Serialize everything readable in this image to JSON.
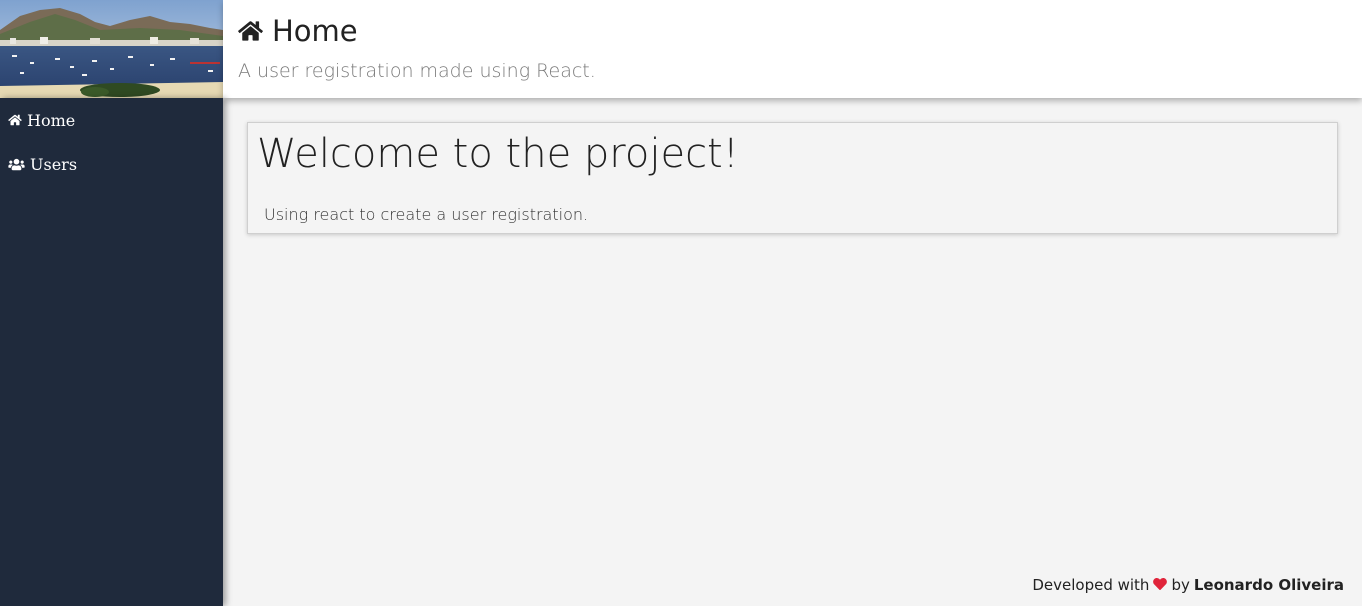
{
  "header": {
    "title": "Home",
    "subtitle": "A user registration made using React.",
    "icon": "home-icon"
  },
  "sidebar": {
    "items": [
      {
        "label": "Home",
        "icon": "home-icon"
      },
      {
        "label": "Users",
        "icon": "users-icon"
      }
    ],
    "background": "#1f2a3c"
  },
  "main": {
    "card": {
      "title": "Welcome to the project!",
      "text": "Using react to create a user registration."
    }
  },
  "footer": {
    "prefix": "Developed with",
    "by": "by",
    "author": "Leonardo Oliveira",
    "heart_color": "#e0243a"
  }
}
